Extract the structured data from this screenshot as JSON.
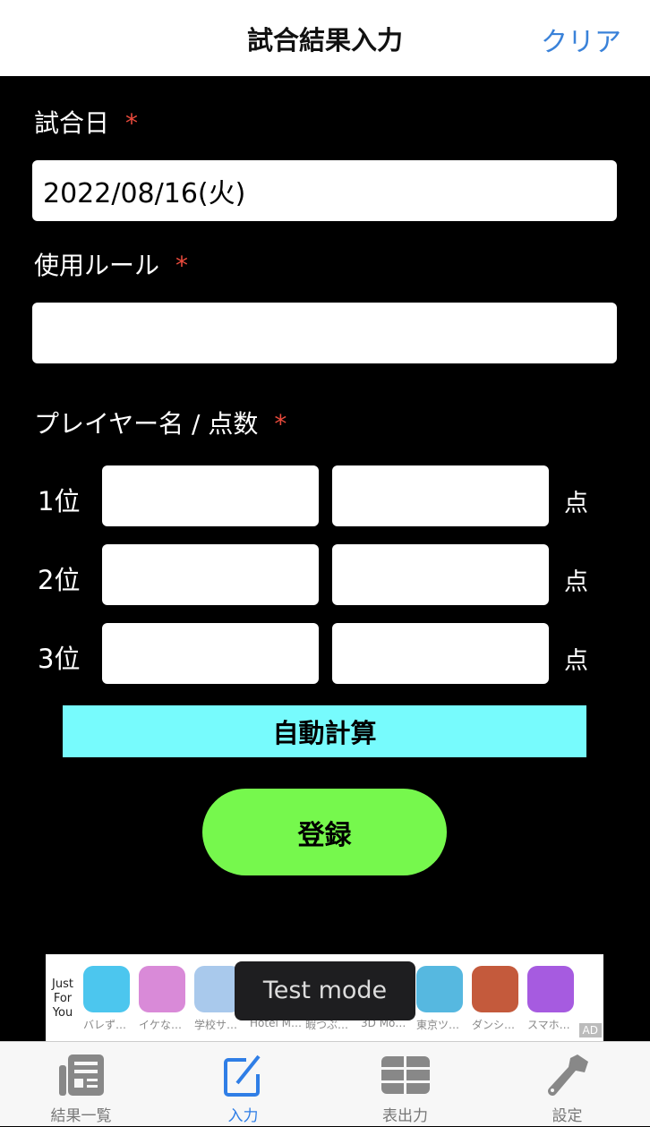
{
  "header": {
    "title": "試合結果入力",
    "clear_label": "クリア"
  },
  "form": {
    "date_label": "試合日",
    "date_value": "2022/08/16(火)",
    "rule_label": "使用ルール",
    "rule_value": "",
    "players_label": "プレイヤー名 / 点数",
    "required_mark": "*",
    "point_unit": "点",
    "rows": [
      {
        "rank": "1位",
        "name": "",
        "score": ""
      },
      {
        "rank": "2位",
        "name": "",
        "score": ""
      },
      {
        "rank": "3位",
        "name": "",
        "score": ""
      }
    ],
    "auto_calc_label": "自動計算",
    "register_label": "登録"
  },
  "ad": {
    "heading": "Just For You",
    "toast": "Test mode",
    "badge": "AD",
    "apps": [
      {
        "name": "バレず…",
        "color": "#4cc6ee"
      },
      {
        "name": "イケな…",
        "color": "#d98ad8"
      },
      {
        "name": "学校サ…",
        "color": "#a9c9ec"
      },
      {
        "name": "Hotel M…",
        "color": "#333"
      },
      {
        "name": "暇つぶ…",
        "color": "#333"
      },
      {
        "name": "3D Mo…",
        "color": "#333"
      },
      {
        "name": "東京ツ…",
        "color": "#56b8e0"
      },
      {
        "name": "ダンシ…",
        "color": "#c45a3c"
      },
      {
        "name": "スマホ…",
        "color": "#a65be0"
      }
    ]
  },
  "tabs": [
    {
      "label": "結果一覧",
      "icon": "newspaper-icon"
    },
    {
      "label": "入力",
      "icon": "edit-icon",
      "active": true
    },
    {
      "label": "表出力",
      "icon": "table-icon"
    },
    {
      "label": "設定",
      "icon": "wrench-icon"
    }
  ],
  "colors": {
    "accent": "#2f7ee6",
    "auto_calc": "#77fbfd",
    "register": "#76f84d",
    "required": "#e94a3c"
  }
}
